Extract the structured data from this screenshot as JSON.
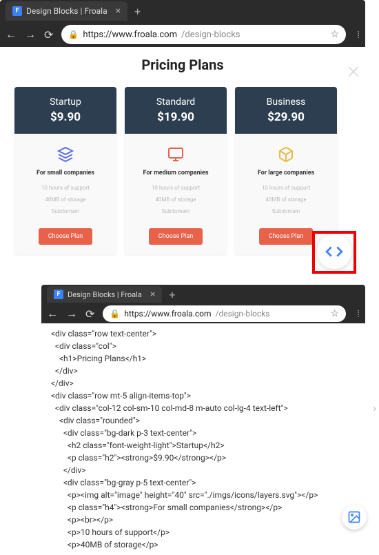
{
  "browser1": {
    "tab_title": "Design Blocks | Froala",
    "url_base": "https://www.froala.com",
    "url_path": "/design-blocks"
  },
  "browser2": {
    "tab_title": "Design Blocks | Froala",
    "url_base": "https://www.froala.com",
    "url_path": "/design-blocks"
  },
  "page": {
    "title": "Pricing Plans"
  },
  "plans": [
    {
      "name": "Startup",
      "price": "$9.90",
      "tag": "For small companies",
      "f1": "10 hours of support",
      "f2": "40MB of storage",
      "f3": "Subdomain",
      "btn": "Choose Plan",
      "iconColor": "#5b6ee1"
    },
    {
      "name": "Standard",
      "price": "$19.90",
      "tag": "For medium companies",
      "f1": "10 hours of support",
      "f2": "40MB of storage",
      "f3": "Subdomain",
      "btn": "Choose Plan",
      "iconColor": "#e8624a"
    },
    {
      "name": "Business",
      "price": "$29.90",
      "tag": "For large companies",
      "f1": "10 hours of support",
      "f2": "40MB of storage",
      "f3": "Subdomain",
      "btn": "Choose Plan",
      "iconColor": "#e8b94a"
    }
  ],
  "code": {
    "l1": "  <div class=\"row text-center\">",
    "l2": "    <div class=\"col\">",
    "l3": "      <h1>Pricing Plans</h1>",
    "l4": "    </div>",
    "l5": "  </div>",
    "l6": "",
    "l7": "  <div class=\"row mt-5 align-items-top\">",
    "l8": "    <div class=\"col-12 col-sm-10 col-md-8 m-auto col-lg-4 text-left\">",
    "l9": "      <div class=\"rounded\">",
    "l10": "        <div class=\"bg-dark p-3 text-center\">",
    "l11": "          <h2 class=\"font-weight-light\">Startup</h2>",
    "l12": "          <p class=\"h2\"><strong>$9.90</strong></p>",
    "l13": "        </div>",
    "l14": "",
    "l15": "        <div class=\"bg-gray p-5 text-center\">",
    "l16": "          <p><img alt=\"image\" height=\"40\" src=\"./imgs/icons/layers.svg\"></p>",
    "l17": "          <p class=\"h4\"><strong>For small companies</strong></p>",
    "l18": "          <p><br></p>",
    "l19": "          <p>10 hours of support</p>",
    "l20": "          <p>40MB of storage</p>"
  }
}
